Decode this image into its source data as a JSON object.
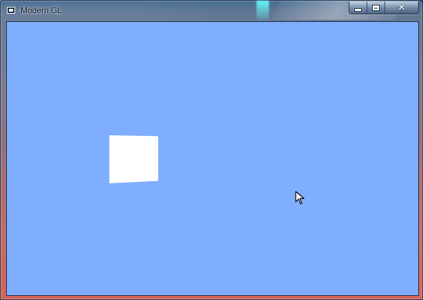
{
  "window": {
    "title": "Modern GL",
    "controls": {
      "minimize_icon": "minimize-icon",
      "maximize_icon": "maximize-icon",
      "close_symbol": "✕"
    }
  },
  "scene": {
    "background_color": "#80aeff",
    "object_color": "#ffffff"
  }
}
